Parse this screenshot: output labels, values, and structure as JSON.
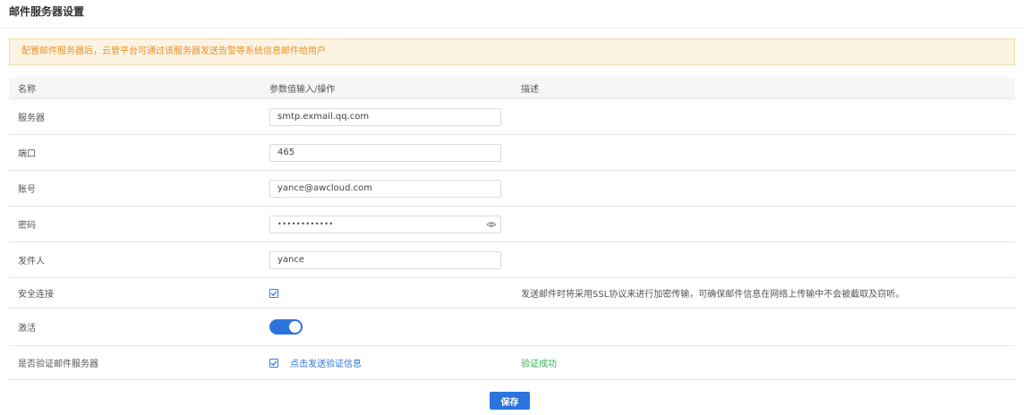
{
  "page": {
    "title": "邮件服务器设置"
  },
  "notice": {
    "text": "配置邮件服务器后，云管平台可通过该服务器发送告警等系统信息邮件给用户"
  },
  "table": {
    "headers": [
      "名称",
      "参数值输入/操作",
      "描述"
    ],
    "rows": {
      "server": {
        "label": "服务器",
        "value": "smtp.exmail.qq.com"
      },
      "port": {
        "label": "端口",
        "value": "465"
      },
      "account": {
        "label": "账号",
        "value": "yance@awcloud.com"
      },
      "password": {
        "label": "密码",
        "value": "••••••••••••",
        "icon": "eye-icon"
      },
      "sender": {
        "label": "发件人",
        "value": "yance"
      },
      "secure": {
        "label": "安全连接",
        "checked": true,
        "description": "发送邮件时将采用SSL协议来进行加密传输，可确保邮件信息在网络上传输中不会被截取及窃听。"
      },
      "active": {
        "label": "激活",
        "enabled": true
      },
      "verify": {
        "label": "是否验证邮件服务器",
        "checked": true,
        "link_label": "点击发送验证信息",
        "status": "验证成功"
      }
    }
  },
  "actions": {
    "save_label": "保存"
  },
  "colors": {
    "accent": "#2d73dd",
    "success": "#32b34a",
    "notice_bg": "#fdf3e2",
    "notice_text": "#e6932d"
  }
}
